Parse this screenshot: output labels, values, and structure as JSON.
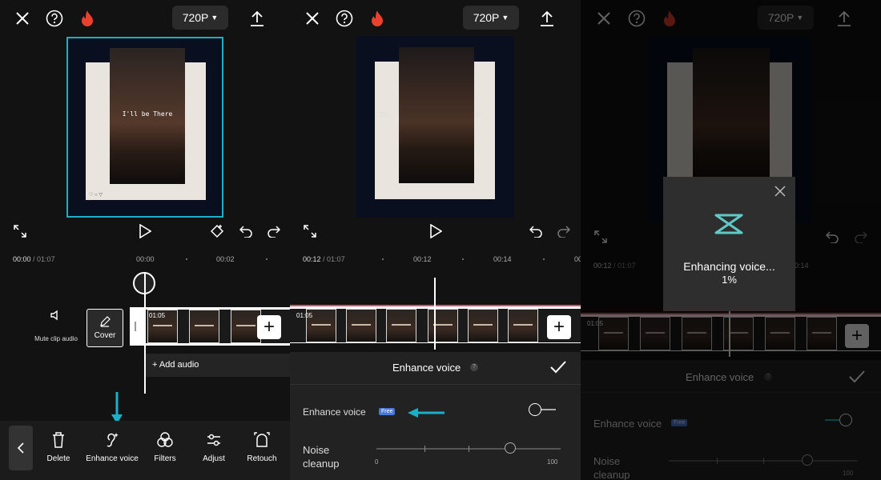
{
  "colors": {
    "accent_cyan": "#1ab0c9",
    "strip_line": "#e0506e",
    "free_badge": "#4a78d8"
  },
  "panels": [
    {
      "resolution": "720P",
      "time_current": "00:00",
      "time_total": "/ 01:07",
      "ruler_ticks": [
        "00:00",
        "00:02"
      ],
      "overlay_text": "I'll be There",
      "clip_duration": "01:05",
      "mute_label": "Mute clip audio",
      "cover_label": "Cover",
      "add_audio_label": "+ Add audio",
      "toolbar": [
        {
          "label": "Delete",
          "icon": "trash-icon"
        },
        {
          "label": "Enhance voice",
          "icon": "enhance-voice-icon"
        },
        {
          "label": "Filters",
          "icon": "filters-icon"
        },
        {
          "label": "Adjust",
          "icon": "adjust-icon"
        },
        {
          "label": "Retouch",
          "icon": "retouch-icon"
        }
      ]
    },
    {
      "resolution": "720P",
      "time_current": "00:12",
      "time_total": "/ 01:07",
      "ruler_ticks": [
        "00:12",
        "00:14",
        "00"
      ],
      "clip_duration": "01:05",
      "sheet_title": "Enhance voice",
      "enhance_label": "Enhance voice",
      "free_badge": "Free",
      "noise_label": "Noise cleanup",
      "slider_min": "0",
      "slider_max": "100",
      "toggle_on": false
    },
    {
      "resolution": "720P",
      "time_current": "00:12",
      "time_total": "/ 01:07",
      "ruler_ticks": [
        "00:14"
      ],
      "clip_duration": "01:05",
      "dialog_text": "Enhancing voice...",
      "dialog_percent": "1%",
      "sheet_title": "Enhance voice",
      "enhance_label": "Enhance voice",
      "free_badge": "Free",
      "noise_label": "Noise cleanup",
      "slider_max": "100",
      "toggle_on": true
    }
  ]
}
